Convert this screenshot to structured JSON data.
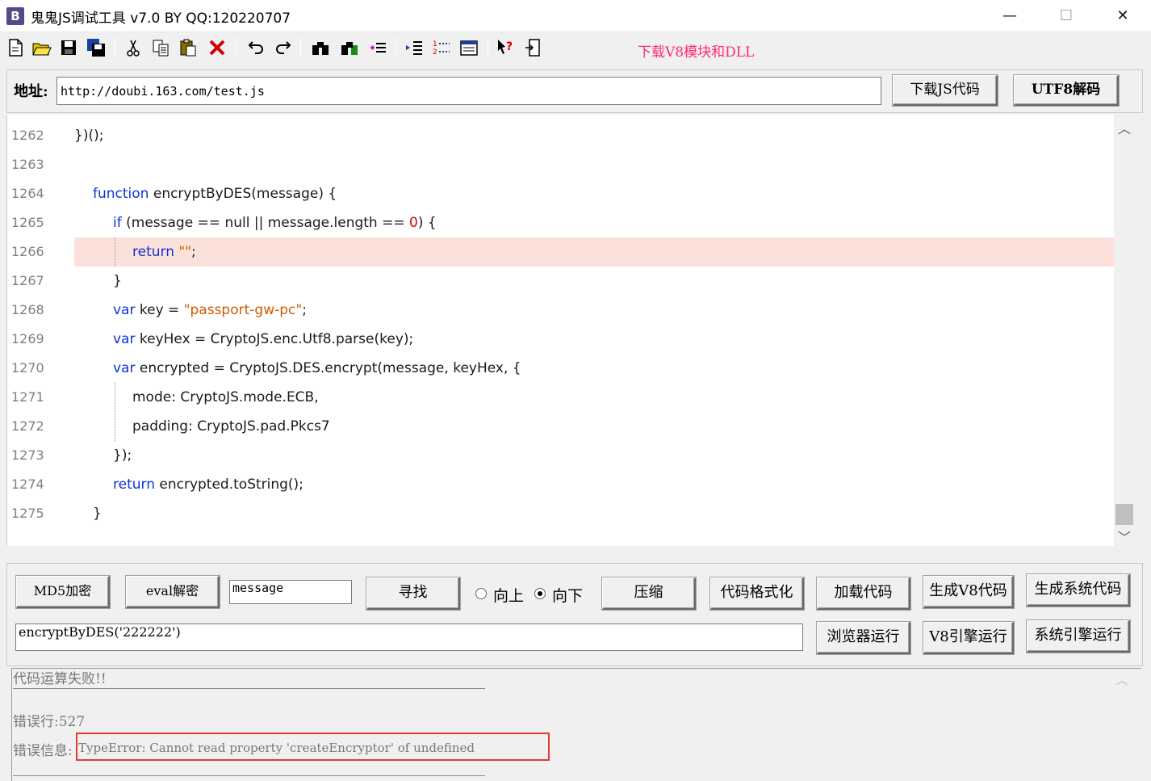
{
  "window": {
    "app_icon_letter": "B",
    "title": "鬼鬼JS调试工具 v7.0 BY QQ:120220707",
    "minimize": "—",
    "maximize": "☐",
    "close": "✕"
  },
  "toolbar": {
    "download_link": "下载V8模块和DLL"
  },
  "address": {
    "label": "地址:",
    "value": "http://doubi.163.com/test.js",
    "download_js_button": "下载JS代码",
    "utf8_decode_button": "UTF8解码"
  },
  "editor": {
    "lines": [
      {
        "num": "1262",
        "code": "})();"
      },
      {
        "num": "1263",
        "code": ""
      },
      {
        "num": "1264",
        "code": "function encryptByDES(message) {"
      },
      {
        "num": "1265",
        "code": "if (message == null || message.length == 0) {"
      },
      {
        "num": "1266",
        "code": "return \"\";"
      },
      {
        "num": "1267",
        "code": "}"
      },
      {
        "num": "1268",
        "code": "var key = \"passport-gw-pc\";"
      },
      {
        "num": "1269",
        "code": "var keyHex = CryptoJS.enc.Utf8.parse(key);"
      },
      {
        "num": "1270",
        "code": "var encrypted = CryptoJS.DES.encrypt(message, keyHex, {"
      },
      {
        "num": "1271",
        "code": "mode: CryptoJS.mode.ECB,"
      },
      {
        "num": "1272",
        "code": "padding: CryptoJS.pad.Pkcs7"
      },
      {
        "num": "1273",
        "code": "});"
      },
      {
        "num": "1274",
        "code": "return encrypted.toString();"
      },
      {
        "num": "1275",
        "code": "}"
      }
    ],
    "tokens": {
      "l1262": "})();",
      "l1264_kw": "function",
      "l1264_rest": " encryptByDES(message) {",
      "l1265_kw": "if",
      "l1265_mid": " (message == null || message.length == ",
      "l1265_num": "0",
      "l1265_end": ") {",
      "l1266_kw": "return",
      "l1266_str": " \"\"",
      "l1266_end": ";",
      "l1267": "}",
      "l1268_kw": "var",
      "l1268_mid": " key = ",
      "l1268_str": "\"passport-gw-pc\"",
      "l1268_end": ";",
      "l1269_kw": "var",
      "l1269_rest": " keyHex = CryptoJS.enc.Utf8.parse(key);",
      "l1270_kw": "var",
      "l1270_rest": " encrypted = CryptoJS.DES.encrypt(message, keyHex, {",
      "l1271": "mode: CryptoJS.mode.ECB,",
      "l1272": "padding: CryptoJS.pad.Pkcs7",
      "l1273": "});",
      "l1274_kw": "return",
      "l1274_rest": " encrypted.toString();",
      "l1275": "}"
    }
  },
  "controls": {
    "md5_button": "MD5加密",
    "eval_decode_button": "eval解密",
    "search_value": "message",
    "find_button": "寻找",
    "radio_up": "向上",
    "radio_down": "向下",
    "compress_button": "压缩",
    "format_button": "代码格式化",
    "load_code_button": "加载代码",
    "gen_v8_button": "生成V8代码",
    "gen_system_button": "生成系统代码",
    "expression_value": "encryptByDES('222222')",
    "browser_run_button": "浏览器运行",
    "v8_run_button": "V8引擎运行",
    "system_run_button": "系统引擎运行"
  },
  "output": {
    "status": "代码运算失败!!",
    "error_line": "错误行:527",
    "error_info_label": "错误信息:",
    "error_message": "TypeError: Cannot read property 'createEncryptor' of undefined"
  }
}
